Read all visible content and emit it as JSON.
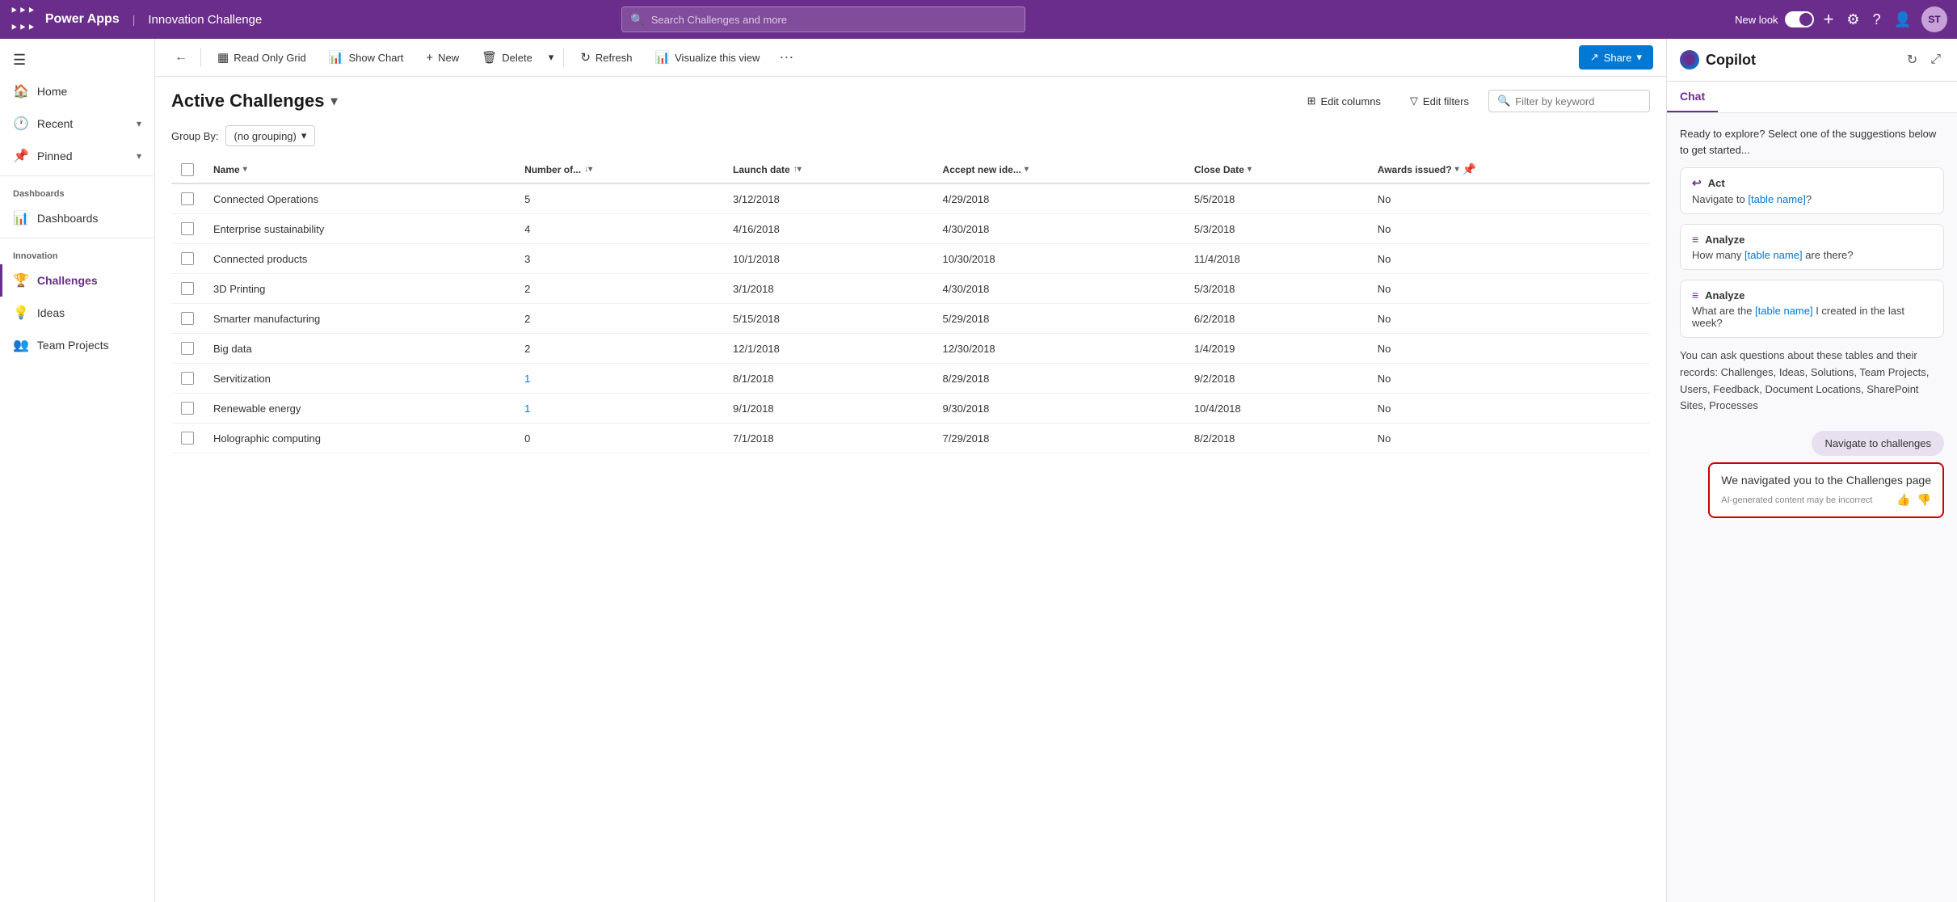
{
  "topNav": {
    "appGridIcon": "⊞",
    "appName": "Power Apps",
    "separator": "|",
    "appTitle": "Innovation Challenge",
    "searchPlaceholder": "Search Challenges and more",
    "newLookLabel": "New look",
    "addIcon": "+",
    "settingsIcon": "⚙",
    "helpIcon": "?",
    "personIcon": "👤",
    "avatarLabel": "ST"
  },
  "sidebar": {
    "toggleIcon": "☰",
    "items": [
      {
        "label": "Home",
        "icon": "🏠",
        "active": false
      },
      {
        "label": "Recent",
        "icon": "🕐",
        "active": false,
        "hasChevron": true
      },
      {
        "label": "Pinned",
        "icon": "📌",
        "active": false,
        "hasChevron": true
      }
    ],
    "sections": [
      {
        "label": "Dashboards",
        "items": [
          {
            "label": "Dashboards",
            "icon": "📊",
            "active": false
          }
        ]
      },
      {
        "label": "Innovation",
        "items": [
          {
            "label": "Challenges",
            "icon": "🏆",
            "active": true
          },
          {
            "label": "Ideas",
            "icon": "💡",
            "active": false
          },
          {
            "label": "Team Projects",
            "icon": "👥",
            "active": false
          }
        ]
      }
    ]
  },
  "toolbar": {
    "backIcon": "←",
    "readOnlyGridLabel": "Read Only Grid",
    "readOnlyGridIcon": "▦",
    "showChartLabel": "Show Chart",
    "showChartIcon": "📊",
    "newLabel": "New",
    "newIcon": "+",
    "deleteLabel": "Delete",
    "deleteIcon": "🗑",
    "dropdownIcon": "▾",
    "refreshLabel": "Refresh",
    "refreshIcon": "↻",
    "visualizeLabel": "Visualize this view",
    "visualizeIcon": "📊",
    "moreIcon": "⋯",
    "shareLabel": "Share",
    "shareIcon": "↗"
  },
  "dataView": {
    "title": "Active Challenges",
    "titleChevron": "▾",
    "groupByLabel": "Group By:",
    "groupByValue": "(no grouping)",
    "groupByChevron": "▾",
    "editColumnsLabel": "Edit columns",
    "editColumnsIcon": "⊞",
    "editFiltersLabel": "Edit filters",
    "editFiltersIcon": "▽",
    "filterPlaceholder": "Filter by keyword",
    "filterIcon": "🔍",
    "pinIcon": "📌",
    "columns": [
      {
        "label": "Name",
        "sortIcon": "▾"
      },
      {
        "label": "Number of...",
        "sortIcon": "↓▾"
      },
      {
        "label": "Launch date",
        "sortIcon": "↑▾"
      },
      {
        "label": "Accept new ide...",
        "sortIcon": "▾"
      },
      {
        "label": "Close Date",
        "sortIcon": "▾"
      },
      {
        "label": "Awards issued?",
        "sortIcon": "▾"
      }
    ],
    "rows": [
      {
        "name": "Connected Operations",
        "number": "5",
        "isLink": false,
        "launchDate": "3/12/2018",
        "acceptDate": "4/29/2018",
        "closeDate": "5/5/2018",
        "awardsIssued": "No"
      },
      {
        "name": "Enterprise sustainability",
        "number": "4",
        "isLink": false,
        "launchDate": "4/16/2018",
        "acceptDate": "4/30/2018",
        "closeDate": "5/3/2018",
        "awardsIssued": "No"
      },
      {
        "name": "Connected products",
        "number": "3",
        "isLink": false,
        "launchDate": "10/1/2018",
        "acceptDate": "10/30/2018",
        "closeDate": "11/4/2018",
        "awardsIssued": "No"
      },
      {
        "name": "3D Printing",
        "number": "2",
        "isLink": false,
        "launchDate": "3/1/2018",
        "acceptDate": "4/30/2018",
        "closeDate": "5/3/2018",
        "awardsIssued": "No"
      },
      {
        "name": "Smarter manufacturing",
        "number": "2",
        "isLink": false,
        "launchDate": "5/15/2018",
        "acceptDate": "5/29/2018",
        "closeDate": "6/2/2018",
        "awardsIssued": "No"
      },
      {
        "name": "Big data",
        "number": "2",
        "isLink": false,
        "launchDate": "12/1/2018",
        "acceptDate": "12/30/2018",
        "closeDate": "1/4/2019",
        "awardsIssued": "No"
      },
      {
        "name": "Servitization",
        "number": "1",
        "isLink": true,
        "launchDate": "8/1/2018",
        "acceptDate": "8/29/2018",
        "closeDate": "9/2/2018",
        "awardsIssued": "No"
      },
      {
        "name": "Renewable energy",
        "number": "1",
        "isLink": true,
        "launchDate": "9/1/2018",
        "acceptDate": "9/30/2018",
        "closeDate": "10/4/2018",
        "awardsIssued": "No"
      },
      {
        "name": "Holographic computing",
        "number": "0",
        "isLink": false,
        "launchDate": "7/1/2018",
        "acceptDate": "7/29/2018",
        "closeDate": "8/2/2018",
        "awardsIssued": "No"
      }
    ]
  },
  "copilot": {
    "title": "Copilot",
    "tabs": [
      {
        "label": "Chat",
        "active": true
      }
    ],
    "introText": "Ready to explore? Select one of the suggestions below to get started...",
    "suggestions": [
      {
        "type": "Act",
        "icon": "↩",
        "text": "Navigate to [table name]?"
      },
      {
        "type": "Analyze",
        "icon": "≡",
        "text": "How many [table name] are there?"
      },
      {
        "type": "Analyze",
        "icon": "≡",
        "text": "What are the [table name] I created in the last week?"
      }
    ],
    "infoText": "You can ask questions about these tables and their records: Challenges, Ideas, Solutions, Team Projects, Users, Feedback, Document Locations, SharePoint Sites, Processes",
    "navigateBubble": "Navigate to challenges",
    "responseText": "We navigated you to the Challenges page",
    "responseFooter": "AI-generated content may be incorrect",
    "thumbUpIcon": "👍",
    "thumbDownIcon": "👎",
    "refreshIcon": "↻",
    "expandIcon": "⤢"
  }
}
